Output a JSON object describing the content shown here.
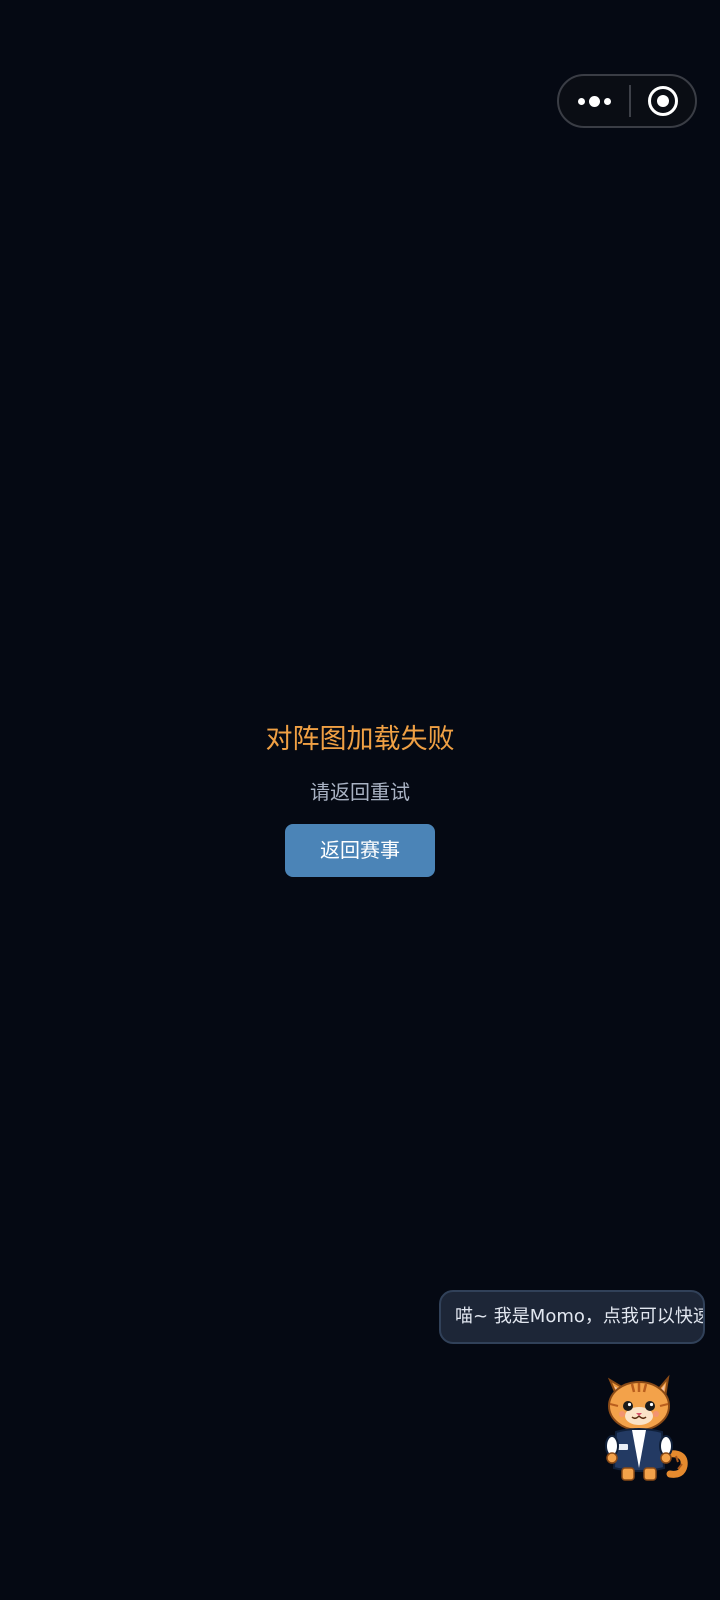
{
  "capsule": {
    "more_icon": "more-dots-icon",
    "close_icon": "target-circle-icon"
  },
  "error": {
    "title": "对阵图加载失败",
    "subtitle": "请返回重试",
    "button_label": "返回赛事"
  },
  "assistant": {
    "bubble_text": "喵~ 我是Momo，点我可以快速",
    "mascot_icon": "cat-mascot-icon"
  },
  "colors": {
    "background": "#050913",
    "title": "#f0a044",
    "subtitle": "#a9b2c3",
    "button": "#4b84b7",
    "bubble": "#1d2637"
  }
}
